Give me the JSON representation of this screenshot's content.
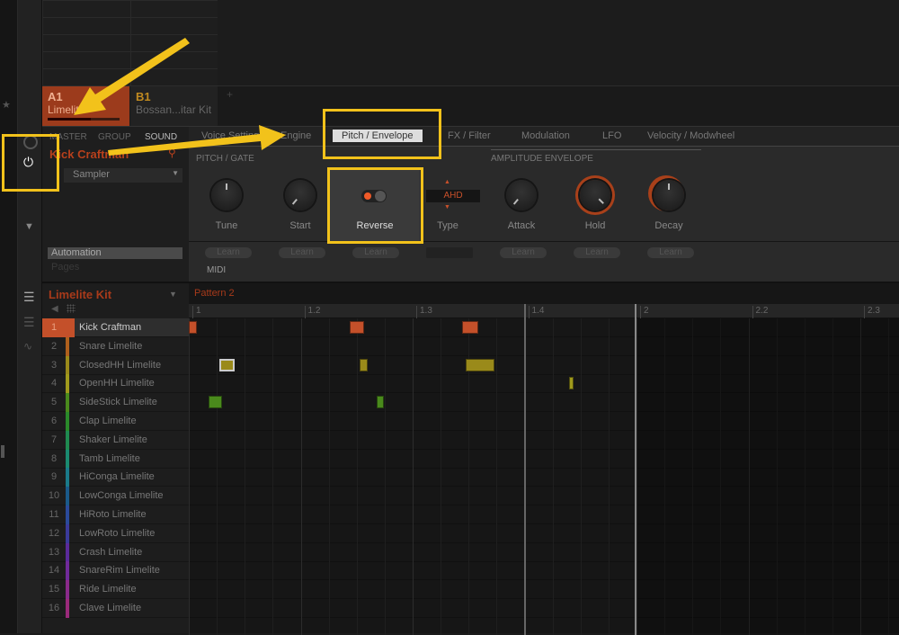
{
  "groups": [
    {
      "id": "A1",
      "name": "Limelite"
    },
    {
      "id": "B1",
      "name": "Bossan...itar Kit"
    }
  ],
  "add_group": "+",
  "plugin": {
    "level_tabs": [
      "MASTER",
      "GROUP",
      "SOUND"
    ],
    "sound_name": "Kick Craftman",
    "plugin_select": "Sampler",
    "automation": "Automation",
    "pages": "Pages",
    "tabs": [
      "Voice Settings",
      "Engine",
      "Pitch / Envelope",
      "FX / Filter",
      "Modulation",
      "LFO",
      "Velocity / Modwheel"
    ],
    "selected_tab": "Pitch / Envelope",
    "sections": {
      "pitch": "PITCH / GATE",
      "amp": "AMPLITUDE ENVELOPE"
    },
    "controls": [
      {
        "label": "Tune",
        "type": "knob",
        "value": 0.5
      },
      {
        "label": "Start",
        "type": "knob",
        "value": 0.1
      },
      {
        "label": "Reverse",
        "type": "toggle",
        "value": "off"
      },
      {
        "label": "Type",
        "type": "selector",
        "value": "AHD"
      },
      {
        "label": "Attack",
        "type": "knob",
        "value": 0.1
      },
      {
        "label": "Hold",
        "type": "knob",
        "value": 0.85
      },
      {
        "label": "Decay",
        "type": "knob",
        "value": 0.5
      }
    ],
    "learn": "Learn",
    "midi": "MIDI"
  },
  "pattern": {
    "kit": "Limelite Kit",
    "name": "Pattern 2",
    "ruler": [
      "1",
      "1.2",
      "1.3",
      "1.4",
      "2",
      "2.2",
      "2.3"
    ],
    "sounds": [
      {
        "n": "1",
        "name": "Kick Craftman",
        "color": "#c4502a"
      },
      {
        "n": "2",
        "name": "Snare Limelite",
        "color": "#b0601c"
      },
      {
        "n": "3",
        "name": "ClosedHH Limelite",
        "color": "#9a8a1a"
      },
      {
        "n": "4",
        "name": "OpenHH Limelite",
        "color": "#a09a1c"
      },
      {
        "n": "5",
        "name": "SideStick Limelite",
        "color": "#4a8a1c"
      },
      {
        "n": "6",
        "name": "Clap Limelite",
        "color": "#2a8a2a"
      },
      {
        "n": "7",
        "name": "Shaker Limelite",
        "color": "#1f8a50"
      },
      {
        "n": "8",
        "name": "Tamb Limelite",
        "color": "#1a8a70"
      },
      {
        "n": "9",
        "name": "HiConga Limelite",
        "color": "#1a7a8a"
      },
      {
        "n": "10",
        "name": "LowConga Limelite",
        "color": "#1a5a8a"
      },
      {
        "n": "11",
        "name": "HiRoto Limelite",
        "color": "#2a4a9a"
      },
      {
        "n": "12",
        "name": "LowRoto Limelite",
        "color": "#3a3a9a"
      },
      {
        "n": "13",
        "name": "Crash Limelite",
        "color": "#5a2a9a"
      },
      {
        "n": "14",
        "name": "SnareRim Limelite",
        "color": "#702a9a"
      },
      {
        "n": "15",
        "name": "Ride Limelite",
        "color": "#8a2a8a"
      },
      {
        "n": "16",
        "name": "Clave Limelite",
        "color": "#9a2a7a"
      }
    ],
    "notes": [
      {
        "row": 0,
        "start": 0.0,
        "len": 0.07
      },
      {
        "row": 0,
        "start": 1.44,
        "len": 0.13
      },
      {
        "row": 0,
        "start": 2.44,
        "len": 0.15
      },
      {
        "row": 2,
        "start": 0.27,
        "len": 0.14,
        "selected": true
      },
      {
        "row": 2,
        "start": 1.53,
        "len": 0.07
      },
      {
        "row": 2,
        "start": 2.47,
        "len": 0.26
      },
      {
        "row": 3,
        "start": 3.4,
        "len": 0.04
      },
      {
        "row": 4,
        "start": 0.18,
        "len": 0.12
      },
      {
        "row": 4,
        "start": 1.68,
        "len": 0.06
      }
    ],
    "loop_end": "2"
  },
  "annotation_color": "#f2c21b"
}
